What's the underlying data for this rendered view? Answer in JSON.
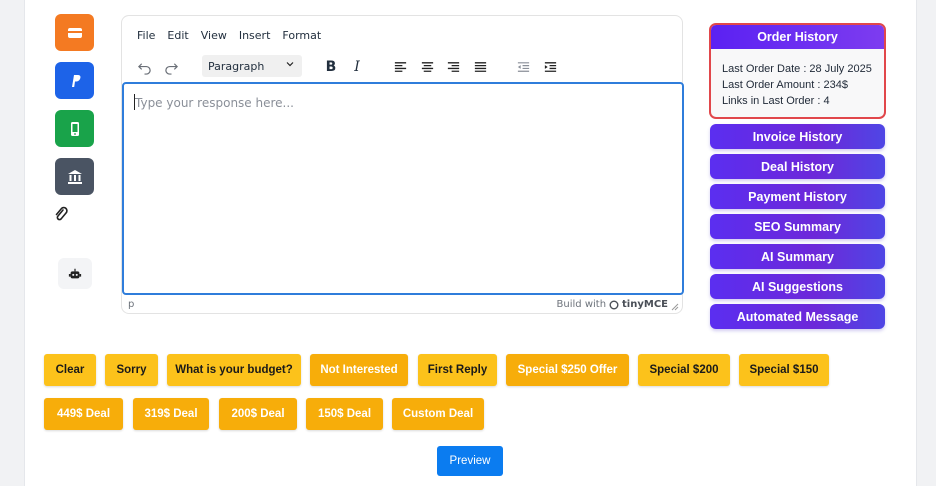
{
  "colors": {
    "orange": "#f47a22",
    "blue": "#1d63e8",
    "green": "#19a34a",
    "slate": "#4a5463",
    "purple": "#5b21f2",
    "yellow": "#fcc21b",
    "preview_blue": "#0b7cf0"
  },
  "sidebar_icons": [
    {
      "name": "credit-card-icon",
      "color": "#f47a22"
    },
    {
      "name": "paypal-icon",
      "color": "#1d63e8"
    },
    {
      "name": "mobile-phone-icon",
      "color": "#19a34a"
    },
    {
      "name": "bank-icon",
      "color": "#4a5463"
    }
  ],
  "editor": {
    "menu": [
      "File",
      "Edit",
      "View",
      "Insert",
      "Format"
    ],
    "format_select": "Paragraph",
    "placeholder": "Type your response here...",
    "status_path": "p",
    "build_with": "Build with",
    "brand": "tinyMCE"
  },
  "order_history": {
    "title": "Order History",
    "last_order_date": "Last Order Date : 28 July 2025",
    "last_order_amount": "Last Order Amount : 234$",
    "links_in_last_order": "Links in Last Order : 4"
  },
  "side_buttons": [
    "Invoice History",
    "Deal History",
    "Payment History",
    "SEO Summary",
    "AI Summary",
    "AI Suggestions",
    "Automated Message"
  ],
  "quick_buttons_row1": [
    "Clear",
    "Sorry",
    "What is your budget?",
    "Not Interested",
    "First Reply",
    "Special $250 Offer",
    "Special $200",
    "Special $150"
  ],
  "quick_buttons_row2": [
    "449$ Deal",
    "319$ Deal",
    "200$ Deal",
    "150$ Deal",
    "Custom Deal"
  ],
  "preview_label": "Preview"
}
